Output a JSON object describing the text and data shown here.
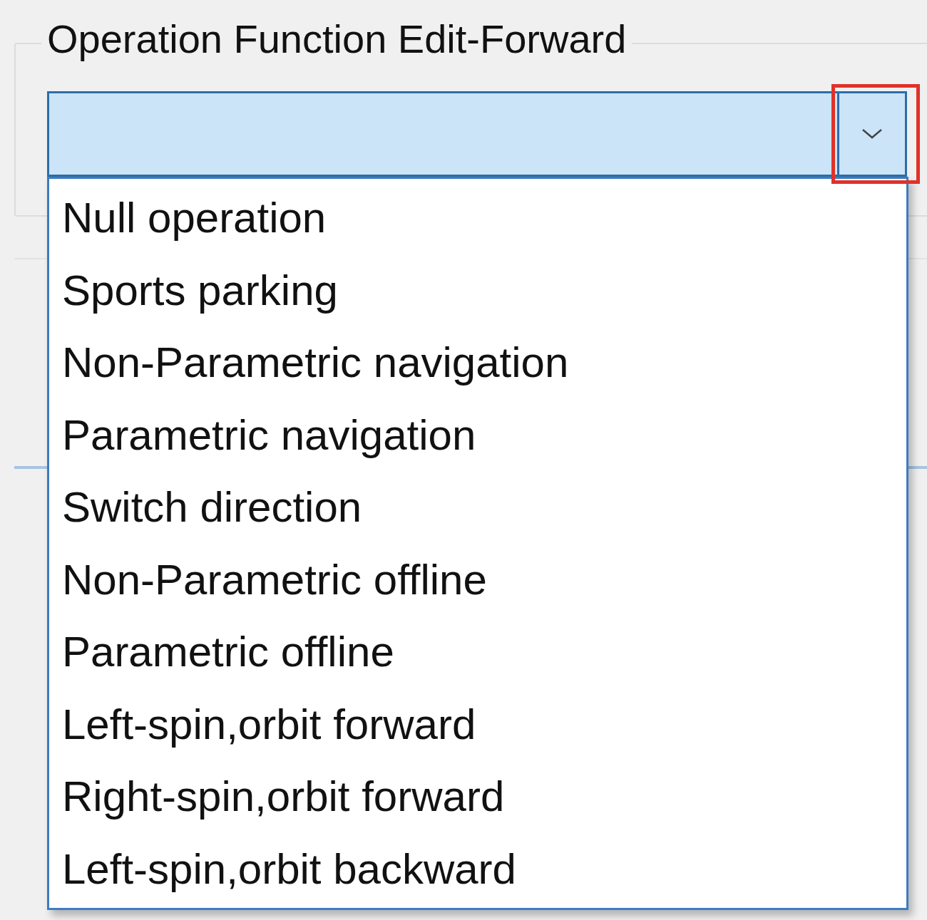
{
  "group": {
    "title": "Operation Function Edit-Forward"
  },
  "combo": {
    "expanded": true,
    "button_highlighted": true
  },
  "options": [
    {
      "label": "Null operation"
    },
    {
      "label": "Sports parking"
    },
    {
      "label": "Non-Parametric navigation"
    },
    {
      "label": "Parametric navigation"
    },
    {
      "label": "Switch direction"
    },
    {
      "label": "Non-Parametric offline"
    },
    {
      "label": "Parametric offline"
    },
    {
      "label": "Left-spin,orbit forward"
    },
    {
      "label": "Right-spin,orbit forward"
    },
    {
      "label": "Left-spin,orbit backward"
    }
  ]
}
